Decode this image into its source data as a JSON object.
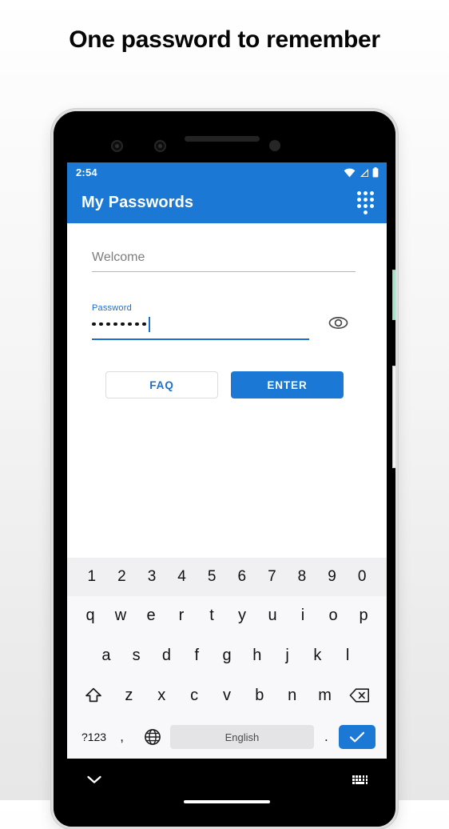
{
  "headline": "One password to remember",
  "phone": {
    "hardware": {
      "sensor_left": "proximity-sensor",
      "sensor_right": "light-sensor",
      "speaker": "earpiece-speaker",
      "camera": "front-camera",
      "power_button": "power-button",
      "volume_button": "volume-rocker"
    }
  },
  "statusbar": {
    "time": "2:54",
    "icons": [
      "wifi-icon",
      "signal-icon",
      "battery-icon"
    ]
  },
  "appbar": {
    "title": "My Passwords",
    "action_icon": "dialpad-icon",
    "background": "#1b78d4"
  },
  "form": {
    "welcome_field": {
      "placeholder": "Welcome",
      "value": ""
    },
    "password_field": {
      "label": "Password",
      "value": "••••••••",
      "dot_count": 8,
      "accent": "#1b6fd0"
    },
    "reveal_icon": "eye-icon",
    "buttons": {
      "faq": "FAQ",
      "enter": "ENTER"
    }
  },
  "keyboard": {
    "language": "English",
    "rows": {
      "numbers": [
        "1",
        "2",
        "3",
        "4",
        "5",
        "6",
        "7",
        "8",
        "9",
        "0"
      ],
      "row1": [
        "q",
        "w",
        "e",
        "r",
        "t",
        "y",
        "u",
        "i",
        "o",
        "p"
      ],
      "row2": [
        "a",
        "s",
        "d",
        "f",
        "g",
        "h",
        "j",
        "k",
        "l"
      ],
      "row3": [
        "z",
        "x",
        "c",
        "v",
        "b",
        "n",
        "m"
      ]
    },
    "shift": "shift-icon",
    "backspace": "backspace-icon",
    "symbols_key": "?123",
    "comma_key": ",",
    "globe_key": "globe-icon",
    "period_key": ".",
    "enter_key": "check-icon",
    "enter_key_color": "#1b78d4"
  },
  "navbar": {
    "back_icon": "chevron-down-icon",
    "keyboard_switch_icon": "keyboard-icon",
    "home_indicator": "home-indicator"
  }
}
